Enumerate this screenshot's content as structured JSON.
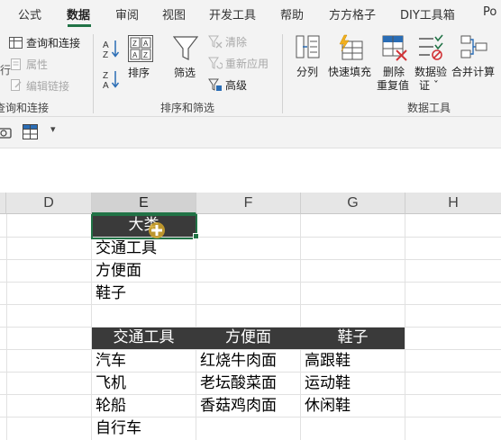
{
  "tabs": [
    "公式",
    "数据",
    "审阅",
    "视图",
    "开发工具",
    "帮助",
    "方方格子",
    "DIY工具箱",
    "Po"
  ],
  "active_tab": "数据",
  "ribbon": {
    "query_group": {
      "label": "查询和连接",
      "items": [
        "查询和连接",
        "属性",
        "编辑链接"
      ],
      "left_fragment": "行",
      "label_fragment": "查询和连接"
    },
    "sort_group": {
      "label": "排序和筛选",
      "sort_label": "排序",
      "filter_label": "筛选",
      "clear_label": "清除",
      "reapply_label": "重新应用",
      "advanced_label": "高级"
    },
    "tools_group": {
      "label": "数据工具",
      "split_label": "分列",
      "flash_fill_label": "快速填充",
      "remove_dup_label": [
        "删除",
        "重复值"
      ],
      "validation_label": [
        "数据验",
        "证 ˇ"
      ],
      "consolidate_label": "合并计算"
    }
  },
  "quick_access": {
    "dropdown": "▾"
  },
  "columns": [
    "D",
    "E",
    "F",
    "G",
    "H"
  ],
  "selected_column": "E",
  "cells": {
    "header_cell": "大类",
    "category_list": [
      "交通工具",
      "方便面",
      "鞋子"
    ],
    "table_headers": [
      "交通工具",
      "方便面",
      "鞋子"
    ],
    "table_rows": [
      [
        "汽车",
        "红烧牛肉面",
        "高跟鞋"
      ],
      [
        "飞机",
        "老坛酸菜面",
        "运动鞋"
      ],
      [
        "轮船",
        "香菇鸡肉面",
        "休闲鞋"
      ],
      [
        "自行车",
        "",
        ""
      ]
    ]
  },
  "colors": {
    "accent": "#217346",
    "dark_fill": "#3a3a3a",
    "cursor": "#d4a72c"
  }
}
